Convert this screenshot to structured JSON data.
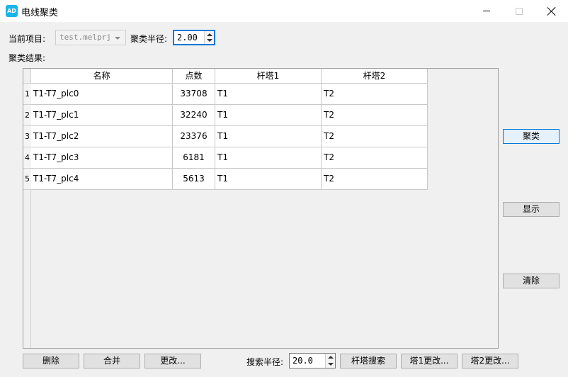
{
  "window": {
    "title": "电线聚类",
    "icon_text": "AD",
    "accent": "#19b5e6"
  },
  "form": {
    "project_label": "当前项目:",
    "project_value": "test.melprj",
    "radius_label": "聚类半径:",
    "radius_value": "2.00",
    "results_label": "聚类结果:"
  },
  "table": {
    "headers": [
      "名称",
      "点数",
      "杆塔1",
      "杆塔2"
    ],
    "rows": [
      {
        "index": "1",
        "name": "T1-T7_plc0",
        "points": "33708",
        "tower1": "T1",
        "tower2": "T2"
      },
      {
        "index": "2",
        "name": "T1-T7_plc1",
        "points": "32240",
        "tower1": "T1",
        "tower2": "T2"
      },
      {
        "index": "3",
        "name": "T1-T7_plc2",
        "points": "23376",
        "tower1": "T1",
        "tower2": "T2"
      },
      {
        "index": "4",
        "name": "T1-T7_plc3",
        "points": "6181",
        "tower1": "T1",
        "tower2": "T2"
      },
      {
        "index": "5",
        "name": "T1-T7_plc4",
        "points": "5613",
        "tower1": "T1",
        "tower2": "T2"
      }
    ]
  },
  "side_buttons": {
    "cluster": "聚类",
    "show": "显示",
    "clear": "清除"
  },
  "bottom": {
    "delete": "删除",
    "merge": "合并",
    "modify": "更改...",
    "search_radius_label": "搜索半径:",
    "search_radius_value": "20.0",
    "tower_search": "杆塔搜索",
    "tower1_modify": "塔1更改...",
    "tower2_modify": "塔2更改..."
  },
  "icons": {
    "app": "app-logo-icon",
    "minimize": "minimize-icon",
    "maximize": "maximize-icon",
    "close": "close-icon",
    "dropdown": "chevron-down-icon"
  }
}
